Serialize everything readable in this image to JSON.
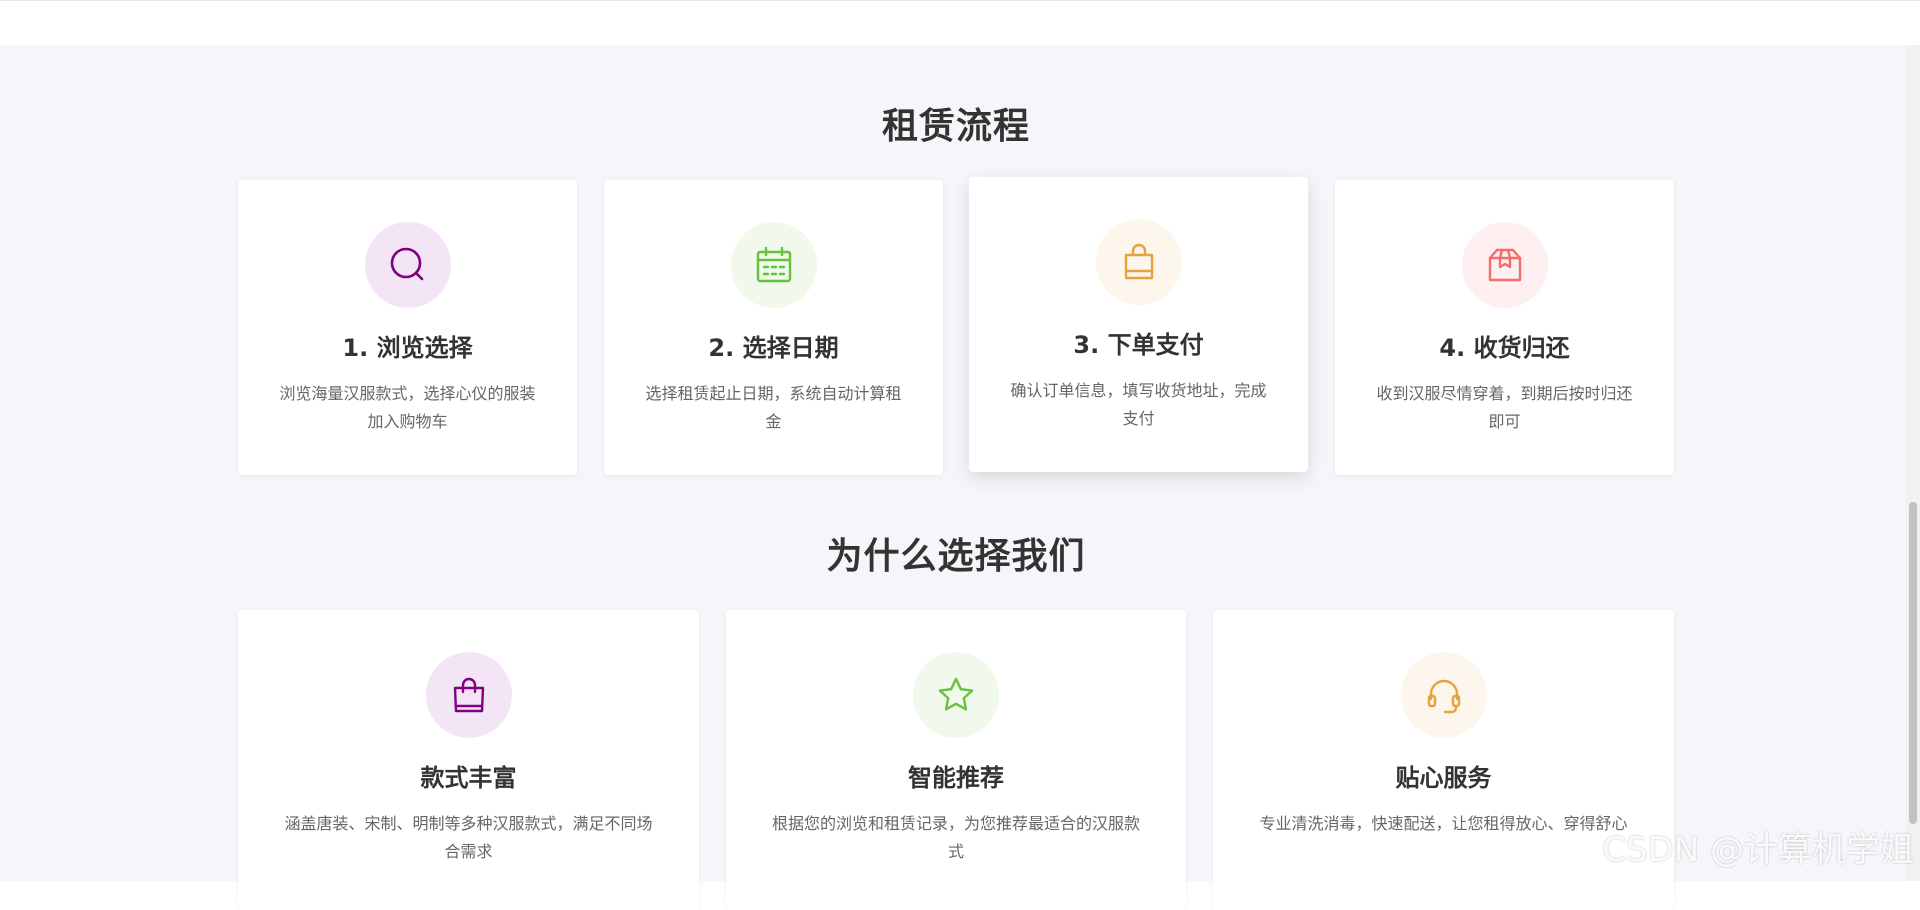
{
  "process": {
    "title": "租赁流程",
    "steps": [
      {
        "title": "1. 浏览选择",
        "desc": "浏览海量汉服款式，选择心仪的服装加入购物车",
        "icon": "search-icon",
        "color": "#800080",
        "bg": "#f3e5f5"
      },
      {
        "title": "2. 选择日期",
        "desc": "选择租赁起止日期，系统自动计算租金",
        "icon": "calendar-icon",
        "color": "#67c23a",
        "bg": "#f0f9eb"
      },
      {
        "title": "3. 下单支付",
        "desc": "确认订单信息，填写收货地址，完成支付",
        "icon": "shopping-bag-icon",
        "color": "#e6a23c",
        "bg": "#fdf6ec"
      },
      {
        "title": "4. 收货归还",
        "desc": "收到汉服尽情穿着，到期后按时归还即可",
        "icon": "box-icon",
        "color": "#f56c6c",
        "bg": "#fef0f0"
      }
    ]
  },
  "why": {
    "title": "为什么选择我们",
    "features": [
      {
        "title": "款式丰富",
        "desc": "涵盖唐装、宋制、明制等多种汉服款式，满足不同场合需求",
        "icon": "handbag-icon",
        "color": "#800080",
        "bg": "#f3e5f5"
      },
      {
        "title": "智能推荐",
        "desc": "根据您的浏览和租赁记录，为您推荐最适合的汉服款式",
        "icon": "star-icon",
        "color": "#67c23a",
        "bg": "#f0f9eb"
      },
      {
        "title": "贴心服务",
        "desc": "专业清洗消毒，快速配送，让您租得放心、穿得舒心",
        "icon": "headset-icon",
        "color": "#e6a23c",
        "bg": "#fdf6ec"
      }
    ]
  },
  "watermark": "CSDN @计算机学姐"
}
